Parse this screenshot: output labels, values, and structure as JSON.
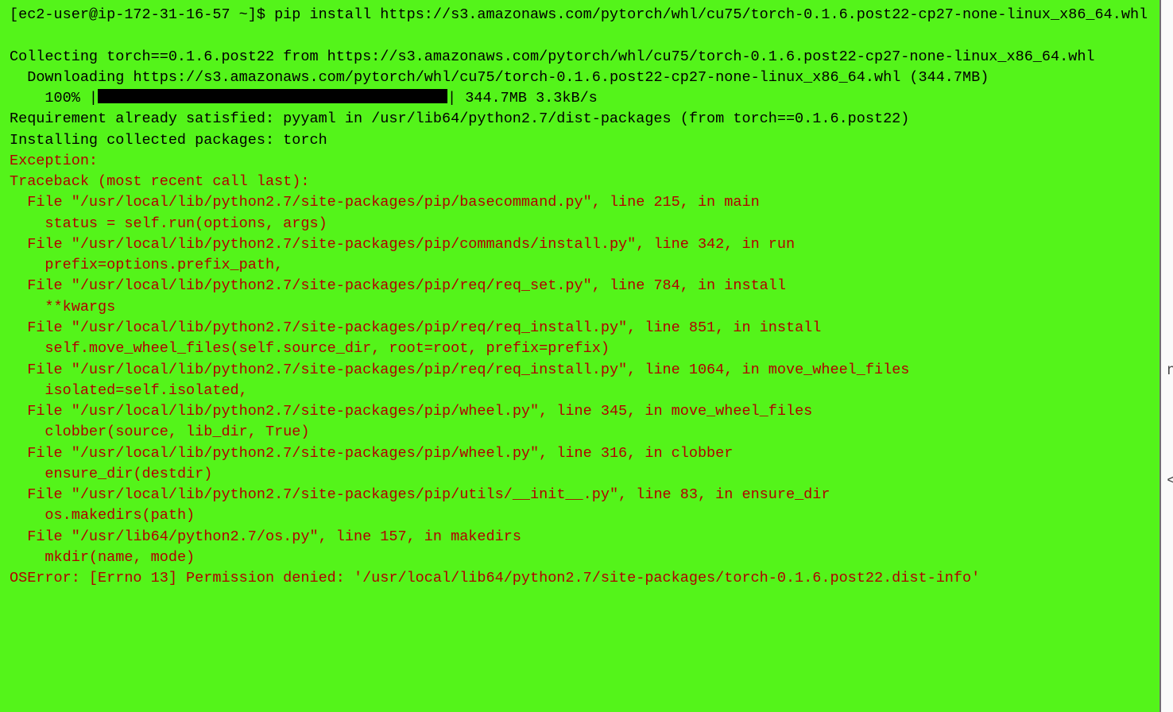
{
  "terminal": {
    "prompt": "[ec2-user@ip-172-31-16-57 ~]$ ",
    "command": "pip install https://s3.amazonaws.com/pytorch/whl/cu75/torch-0.1.6.post22-cp27-none-linux_x86_64.whl",
    "blank1": "",
    "collecting": "Collecting torch==0.1.6.post22 from https://s3.amazonaws.com/pytorch/whl/cu75/torch-0.1.6.post22-cp27-none-linux_x86_64.whl",
    "downloading": "  Downloading https://s3.amazonaws.com/pytorch/whl/cu75/torch-0.1.6.post22-cp27-none-linux_x86_64.whl (344.7MB)",
    "progress_prefix": "    100% |",
    "progress_suffix": "| 344.7MB 3.3kB/s",
    "requirement": "Requirement already satisfied: pyyaml in /usr/lib64/python2.7/dist-packages (from torch==0.1.6.post22)",
    "installing": "Installing collected packages: torch",
    "exception": "Exception:",
    "traceback_header": "Traceback (most recent call last):",
    "tb1a": "  File \"/usr/local/lib/python2.7/site-packages/pip/basecommand.py\", line 215, in main",
    "tb1b": "    status = self.run(options, args)",
    "tb2a": "  File \"/usr/local/lib/python2.7/site-packages/pip/commands/install.py\", line 342, in run",
    "tb2b": "    prefix=options.prefix_path,",
    "tb3a": "  File \"/usr/local/lib/python2.7/site-packages/pip/req/req_set.py\", line 784, in install",
    "tb3b": "    **kwargs",
    "tb4a": "  File \"/usr/local/lib/python2.7/site-packages/pip/req/req_install.py\", line 851, in install",
    "tb4b": "    self.move_wheel_files(self.source_dir, root=root, prefix=prefix)",
    "tb5a": "  File \"/usr/local/lib/python2.7/site-packages/pip/req/req_install.py\", line 1064, in move_wheel_files",
    "tb5b": "    isolated=self.isolated,",
    "tb6a": "  File \"/usr/local/lib/python2.7/site-packages/pip/wheel.py\", line 345, in move_wheel_files",
    "tb6b": "    clobber(source, lib_dir, True)",
    "tb7a": "  File \"/usr/local/lib/python2.7/site-packages/pip/wheel.py\", line 316, in clobber",
    "tb7b": "    ensure_dir(destdir)",
    "tb8a": "  File \"/usr/local/lib/python2.7/site-packages/pip/utils/__init__.py\", line 83, in ensure_dir",
    "tb8b": "    os.makedirs(path)",
    "tb9a": "  File \"/usr/lib64/python2.7/os.py\", line 157, in makedirs",
    "tb9b": "    mkdir(name, mode)",
    "oserror": "OSError: [Errno 13] Permission denied: '/usr/local/lib64/python2.7/site-packages/torch-0.1.6.post22.dist-info'"
  },
  "background": {
    "nu": "nu",
    "m": "<m"
  }
}
